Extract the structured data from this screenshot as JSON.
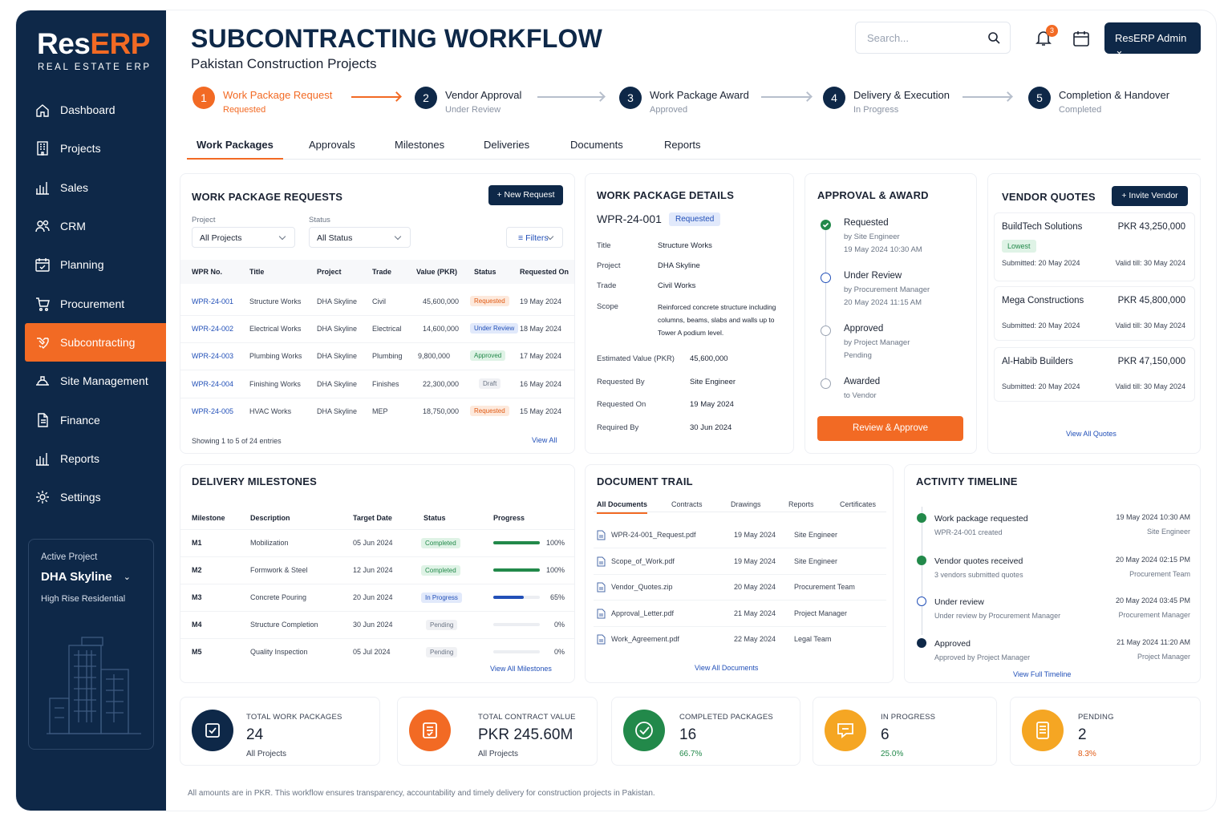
{
  "brand": {
    "logo_res": "Res",
    "logo_erp": "ERP",
    "tagline": "REAL ESTATE ERP"
  },
  "sidebar": {
    "items": [
      {
        "label": "Dashboard",
        "icon": "home-icon"
      },
      {
        "label": "Projects",
        "icon": "building-icon"
      },
      {
        "label": "Sales",
        "icon": "bar-chart-icon"
      },
      {
        "label": "CRM",
        "icon": "users-icon"
      },
      {
        "label": "Planning",
        "icon": "calendar-check-icon"
      },
      {
        "label": "Procurement",
        "icon": "cart-icon"
      },
      {
        "label": "Subcontracting",
        "icon": "handshake-icon"
      },
      {
        "label": "Site Management",
        "icon": "helmet-icon"
      },
      {
        "label": "Finance",
        "icon": "document-icon"
      },
      {
        "label": "Reports",
        "icon": "bar-chart-icon"
      },
      {
        "label": "Settings",
        "icon": "gear-icon"
      }
    ],
    "active_project": {
      "label": "Active Project",
      "name": "DHA Skyline",
      "type": "High Rise Residential"
    }
  },
  "header": {
    "title": "SUBCONTRACTING WORKFLOW",
    "subtitle": "Pakistan Construction Projects",
    "search_placeholder": "Search...",
    "notif_count": "3",
    "user": "ResERP Admin"
  },
  "steps": [
    {
      "n": "1",
      "title": "Work Package Request",
      "status": "Requested"
    },
    {
      "n": "2",
      "title": "Vendor Approval",
      "status": "Under Review"
    },
    {
      "n": "3",
      "title": "Work Package Award",
      "status": "Approved"
    },
    {
      "n": "4",
      "title": "Delivery & Execution",
      "status": "In Progress"
    },
    {
      "n": "5",
      "title": "Completion & Handover",
      "status": "Completed"
    }
  ],
  "tabs": [
    "Work Packages",
    "Approvals",
    "Milestones",
    "Deliveries",
    "Documents",
    "Reports"
  ],
  "wpr": {
    "title": "WORK PACKAGE REQUESTS",
    "new_btn": "+ New Request",
    "project_label": "Project",
    "project_value": "All Projects",
    "status_label": "Status",
    "status_value": "All Status",
    "filters": "Filters",
    "headers": [
      "WPR No.",
      "Title",
      "Project",
      "Trade",
      "Value (PKR)",
      "Status",
      "Requested On"
    ],
    "rows": [
      {
        "no": "WPR-24-001",
        "title": "Structure Works",
        "project": "DHA Skyline",
        "trade": "Civil",
        "value": "45,600,000",
        "status": "Requested",
        "date": "19 May 2024"
      },
      {
        "no": "WPR-24-002",
        "title": "Electrical Works",
        "project": "DHA Skyline",
        "trade": "Electrical",
        "value": "14,600,000",
        "status": "Under Review",
        "date": "18 May 2024"
      },
      {
        "no": "WPR-24-003",
        "title": "Plumbing Works",
        "project": "DHA Skyline",
        "trade": "Plumbing",
        "value": "9,800,000",
        "status": "Approved",
        "date": "17 May 2024"
      },
      {
        "no": "WPR-24-004",
        "title": "Finishing Works",
        "project": "DHA Skyline",
        "trade": "Finishes",
        "value": "22,300,000",
        "status": "Draft",
        "date": "16 May 2024"
      },
      {
        "no": "WPR-24-005",
        "title": "HVAC Works",
        "project": "DHA Skyline",
        "trade": "MEP",
        "value": "18,750,000",
        "status": "Requested",
        "date": "15 May 2024"
      }
    ],
    "showing": "Showing 1 to 5 of 24 entries",
    "view_all": "View All"
  },
  "details": {
    "title": "WORK PACKAGE DETAILS",
    "id": "WPR-24-001",
    "status": "Requested",
    "fields": [
      {
        "k": "Title",
        "v": "Structure Works"
      },
      {
        "k": "Project",
        "v": "DHA Skyline"
      },
      {
        "k": "Trade",
        "v": "Civil Works"
      }
    ],
    "scope_label": "Scope",
    "scope": [
      "Reinforced concrete structure including",
      "columns, beams, slabs and walls up to",
      "Tower A podium level."
    ],
    "fields2": [
      {
        "k": "Estimated Value (PKR)",
        "v": "45,600,000"
      },
      {
        "k": "Requested By",
        "v": "Site Engineer"
      },
      {
        "k": "Requested On",
        "v": "19 May 2024"
      },
      {
        "k": "Required By",
        "v": "30 Jun 2024"
      }
    ]
  },
  "approval": {
    "title": "APPROVAL & AWARD",
    "steps": [
      {
        "t": "Requested",
        "a": "by Site Engineer",
        "b": "19 May 2024 10:30 AM"
      },
      {
        "t": "Under Review",
        "a": "by Procurement Manager",
        "b": "20 May 2024 11:15 AM"
      },
      {
        "t": "Approved",
        "a": "by Project Manager",
        "b": "Pending"
      },
      {
        "t": "Awarded",
        "a": "to Vendor",
        "b": ""
      }
    ],
    "btn": "Review & Approve"
  },
  "quotes": {
    "title": "VENDOR QUOTES",
    "btn": "+ Invite Vendor",
    "items": [
      {
        "name": "BuildTech Solutions",
        "amount": "PKR 43,250,000",
        "tag": "Lowest",
        "sub": "Submitted: 20 May 2024",
        "valid": "Valid till: 30 May 2024"
      },
      {
        "name": "Mega Constructions",
        "amount": "PKR 45,800,000",
        "tag": "",
        "sub": "Submitted: 20 May 2024",
        "valid": "Valid till: 30 May 2024"
      },
      {
        "name": "Al-Habib Builders",
        "amount": "PKR 47,150,000",
        "tag": "",
        "sub": "Submitted: 20 May 2024",
        "valid": "Valid till: 30 May 2024"
      }
    ],
    "view_all": "View All Quotes"
  },
  "milestones": {
    "title": "DELIVERY MILESTONES",
    "headers": [
      "Milestone",
      "Description",
      "Target Date",
      "Status",
      "Progress"
    ],
    "rows": [
      {
        "id": "M1",
        "desc": "Mobilization",
        "date": "05 Jun 2024",
        "status": "Completed",
        "pct": "100%",
        "p": 1
      },
      {
        "id": "M2",
        "desc": "Formwork & Steel",
        "date": "12 Jun 2024",
        "status": "Completed",
        "pct": "100%",
        "p": 1
      },
      {
        "id": "M3",
        "desc": "Concrete Pouring",
        "date": "20 Jun 2024",
        "status": "In Progress",
        "pct": "65%",
        "p": 0.65
      },
      {
        "id": "M4",
        "desc": "Structure Completion",
        "date": "30 Jun 2024",
        "status": "Pending",
        "pct": "0%",
        "p": 0
      },
      {
        "id": "M5",
        "desc": "Quality Inspection",
        "date": "05 Jul 2024",
        "status": "Pending",
        "pct": "0%",
        "p": 0
      }
    ],
    "view_all": "View All Milestones"
  },
  "docs": {
    "title": "DOCUMENT TRAIL",
    "tabs": [
      "All Documents",
      "Contracts",
      "Drawings",
      "Reports",
      "Certificates"
    ],
    "rows": [
      {
        "file": "WPR-24-001_Request.pdf",
        "date": "19 May 2024",
        "by": "Site Engineer"
      },
      {
        "file": "Scope_of_Work.pdf",
        "date": "19 May 2024",
        "by": "Site Engineer"
      },
      {
        "file": "Vendor_Quotes.zip",
        "date": "20 May 2024",
        "by": "Procurement Team"
      },
      {
        "file": "Approval_Letter.pdf",
        "date": "21 May 2024",
        "by": "Project Manager"
      },
      {
        "file": "Work_Agreement.pdf",
        "date": "22 May 2024",
        "by": "Legal Team"
      }
    ],
    "view_all": "View All Documents"
  },
  "timeline": {
    "title": "ACTIVITY TIMELINE",
    "items": [
      {
        "t": "Work package requested",
        "s": "WPR-24-001 created",
        "d": "19 May 2024 10:30 AM",
        "by": "Site Engineer"
      },
      {
        "t": "Vendor quotes received",
        "s": "3 vendors submitted quotes",
        "d": "20 May 2024 02:15 PM",
        "by": "Procurement Team"
      },
      {
        "t": "Under review",
        "s": "Under review by Procurement Manager",
        "d": "20 May 2024 03:45 PM",
        "by": "Procurement Manager"
      },
      {
        "t": "Approved",
        "s": "Approved by Project Manager",
        "d": "21 May 2024 11:20 AM",
        "by": "Project Manager"
      }
    ],
    "view_all": "View Full Timeline"
  },
  "stats": [
    {
      "label": "TOTAL WORK PACKAGES",
      "value": "24",
      "sub": "All Projects",
      "color": "#0e2848"
    },
    {
      "label": "TOTAL CONTRACT VALUE",
      "value": "PKR  245.60M",
      "sub": "All Projects",
      "color": "#f26a24"
    },
    {
      "label": "COMPLETED PACKAGES",
      "value": "16",
      "sub": "66.7%",
      "color": "#22894a"
    },
    {
      "label": "IN PROGRESS",
      "value": "6",
      "sub": "25.0%",
      "color": "#f5a623"
    },
    {
      "label": "PENDING",
      "value": "2",
      "sub": "8.3%",
      "color": "#f5a623"
    }
  ],
  "footer": "All amounts are in PKR. This workflow ensures transparency, accountability and timely delivery for construction projects in Pakistan.",
  "colors": {
    "navy": "#0e2848",
    "orange": "#f26a24",
    "green": "#22894a",
    "blue": "#2250b8",
    "amber": "#f5a623"
  }
}
